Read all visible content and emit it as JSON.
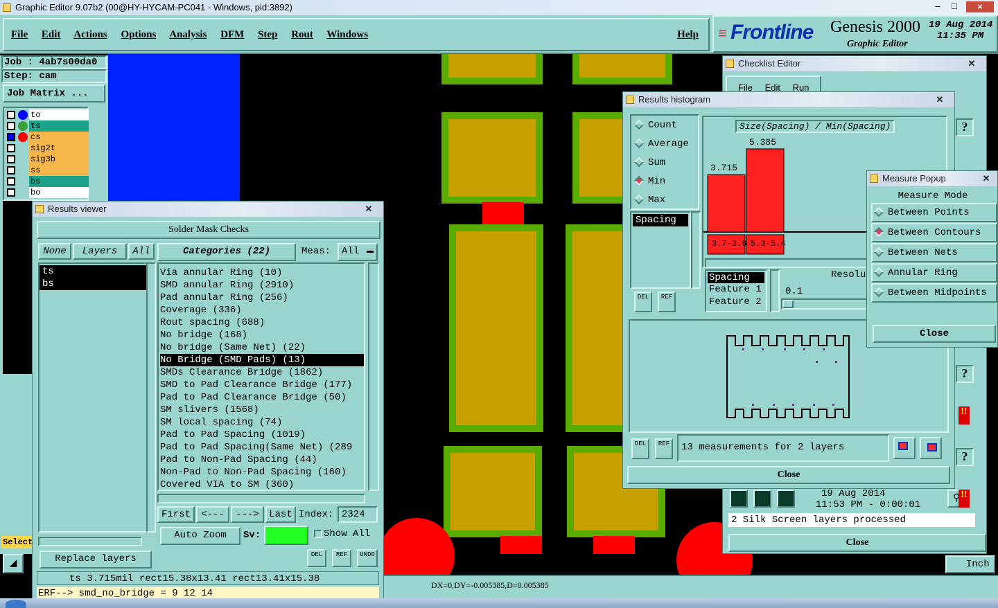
{
  "app": {
    "title": "Graphic Editor 9.07b2 (00@HY-HYCAM-PC041 - Windows, pid:3892)",
    "menu": [
      "File",
      "Edit",
      "Actions",
      "Options",
      "Analysis",
      "DFM",
      "Step",
      "Rout",
      "Windows"
    ],
    "help": "Help",
    "brand": "Frontline",
    "product": "Genesis 2000",
    "subtitle": "Graphic Editor",
    "date": "19 Aug 2014",
    "time": "11:35 PM"
  },
  "left_panel": {
    "job": "Job : 4ab7s00da0",
    "step": "Step: cam",
    "job_matrix": "Job Matrix ...",
    "layers": [
      {
        "name": "to",
        "color": "#ffffff",
        "dot": "#0000ff"
      },
      {
        "name": "ts",
        "color": "#1aa38a",
        "dot": "#3aa13a"
      },
      {
        "name": "cs",
        "color": "#f7b64a",
        "dot": "#ff0000"
      },
      {
        "name": "sig2t",
        "color": "#f7b64a",
        "dot": ""
      },
      {
        "name": "sig3b",
        "color": "#f7b64a",
        "dot": ""
      },
      {
        "name": "ss",
        "color": "#f7b64a",
        "dot": ""
      },
      {
        "name": "bs",
        "color": "#1aa38a",
        "dot": ""
      },
      {
        "name": "bo",
        "color": "#ffffff",
        "dot": ""
      }
    ],
    "select_label": "Select"
  },
  "results_viewer": {
    "title": "Results viewer",
    "header": "Solder Mask Checks",
    "none": "None",
    "layers": "Layers",
    "all": "All",
    "categories": "Categories (22)",
    "meas_label": "Meas:",
    "meas_value": "All",
    "layer_list": [
      "ts",
      "bs"
    ],
    "category_list": [
      "Via annular Ring (10)",
      "SMD annular Ring (2910)",
      "Pad annular Ring (256)",
      "Coverage (336)",
      "Rout spacing (688)",
      "No bridge (168)",
      "No bridge (Same Net) (22)",
      "No Bridge (SMD Pads) (13)",
      "SMDs Clearance Bridge (1862)",
      "SMD to Pad Clearance Bridge (177)",
      "Pad to Pad Clearance Bridge (50)",
      "SM slivers (1568)",
      "SM local spacing (74)",
      "Pad to Pad Spacing (1019)",
      "Pad to Pad Spacing(Same Net) (289",
      "Pad to Non-Pad Spacing (44)",
      "Non-Pad to Non-Pad Spacing (160)",
      "Covered VIA to SM (360)"
    ],
    "selected_index": 7,
    "first": "First",
    "prev": "<---",
    "next": "--->",
    "last": "Last",
    "index_label": "Index:",
    "index_value": "2324",
    "auto_zoom": "Auto Zoom",
    "sv_label": "Sv:",
    "show_all": "Show All",
    "replace_layers": "Replace layers",
    "del": "DEL",
    "ref": "REF",
    "undo": "UNDO",
    "status": "ts 3.715mil  rect15.38x13.41  rect13.41x15.38",
    "erf": "ERF--> smd_no_bridge = 9 12 14"
  },
  "checklist": {
    "title": "Checklist Editor",
    "menu": [
      "File",
      "Edit",
      "Run"
    ],
    "date": "19 Aug 2014",
    "time": "11:53 PM - 0:00:01",
    "msg": "2 Silk Screen layers processed",
    "close": "Close",
    "unit": "Inch"
  },
  "histogram": {
    "title": "Results histogram",
    "modes": [
      "Count",
      "Average",
      "Sum",
      "Min",
      "Max"
    ],
    "selected_mode": "Min",
    "chart_title": "Size(Spacing) / Min(Spacing)",
    "list_item": "Spacing",
    "col_headers": [
      "Spacing",
      "Feature 1",
      "Feature 2"
    ],
    "resol_label": "Resolu",
    "resol_value": "0.1",
    "measurements": "13 measurements for 2 layers",
    "close": "Close",
    "del": "DEL",
    "ref": "REF"
  },
  "chart_data": {
    "type": "bar",
    "title": "Size(Spacing) / Min(Spacing)",
    "categories": [
      "3.7-3.8",
      "5.3-5.4"
    ],
    "values": [
      3.715,
      5.385
    ],
    "value_labels": [
      "3.715",
      "5.385"
    ],
    "bar_color": "#ff2020"
  },
  "measure_popup": {
    "title": "Measure Popup",
    "header": "Measure Mode",
    "modes": [
      "Between Points",
      "Between Contours",
      "Between Nets",
      "Annular Ring",
      "Between Midpoints"
    ],
    "selected": "Between Contours",
    "close": "Close"
  },
  "bottom": {
    "coords": "DX=0,DY=-0.005385,D=0.005385"
  }
}
